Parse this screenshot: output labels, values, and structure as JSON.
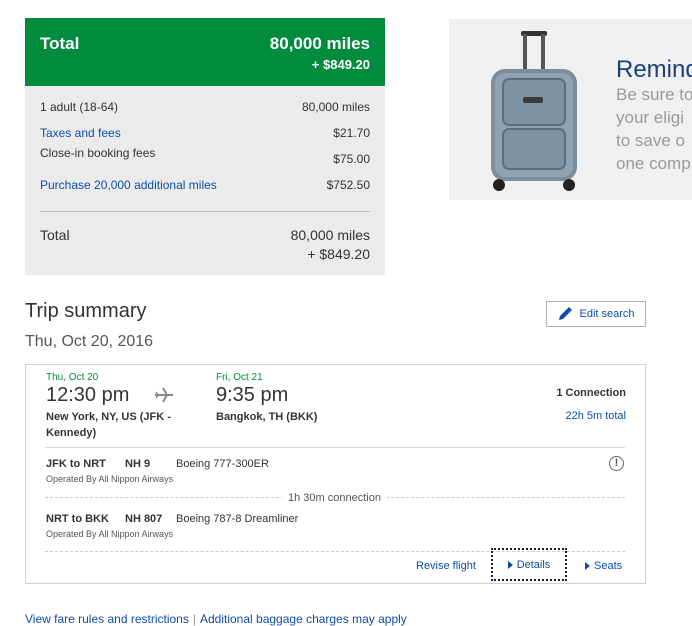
{
  "price": {
    "header_label": "Total",
    "header_miles": "80,000 miles",
    "header_cash": "+ $849.20",
    "rows": [
      {
        "label": "1 adult (18-64)",
        "value": "80,000 miles"
      },
      {
        "label": "Taxes and fees",
        "value": "$21.70"
      },
      {
        "label": "Close-in booking fees",
        "value": "$75.00"
      },
      {
        "label": "Purchase 20,000 additional miles",
        "value": "$752.50"
      }
    ],
    "total_label": "Total",
    "total_miles": "80,000 miles",
    "total_cash": "+ $849.20"
  },
  "ad": {
    "title": "Remind",
    "lines": [
      "Be sure to",
      "your eligi",
      "to save o",
      "one comp"
    ]
  },
  "trip": {
    "title": "Trip summary",
    "date": "Thu, Oct 20, 2016",
    "edit_label": "Edit search",
    "depart_date": "Thu, Oct 20",
    "depart_time": "12:30 pm",
    "depart_place_1": "New York, NY, US (JFK -",
    "depart_place_2": "Kennedy)",
    "arrive_date": "Fri, Oct 21",
    "arrive_time": "9:35 pm",
    "arrive_place": "Bangkok, TH (BKK)",
    "connections": "1 Connection",
    "total_time": "22h 5m total",
    "segments": [
      {
        "route": "JFK to NRT",
        "flight": "NH 9",
        "aircraft": "Boeing 777-300ER",
        "operator": "Operated By All Nippon Airways"
      },
      {
        "route": "NRT to BKK",
        "flight": "NH 807",
        "aircraft": "Boeing 787-8 Dreamliner",
        "operator": "Operated By All Nippon Airways"
      }
    ],
    "connection_label": "1h 30m connection",
    "revise_label": "Revise flight",
    "details_label": "Details",
    "seats_label": "Seats",
    "info_glyph": "!"
  },
  "footer": {
    "fare_rules": "View fare rules and restrictions",
    "baggage": "Additional baggage charges may apply"
  },
  "icons": {
    "plane": "plane-icon",
    "pencil": "pencil-icon",
    "suitcase": "suitcase-image",
    "info": "info-icon"
  },
  "colors": {
    "brand_green": "#008c3c",
    "link_blue": "#0c4dab",
    "panel_gray": "#ebebeb"
  }
}
